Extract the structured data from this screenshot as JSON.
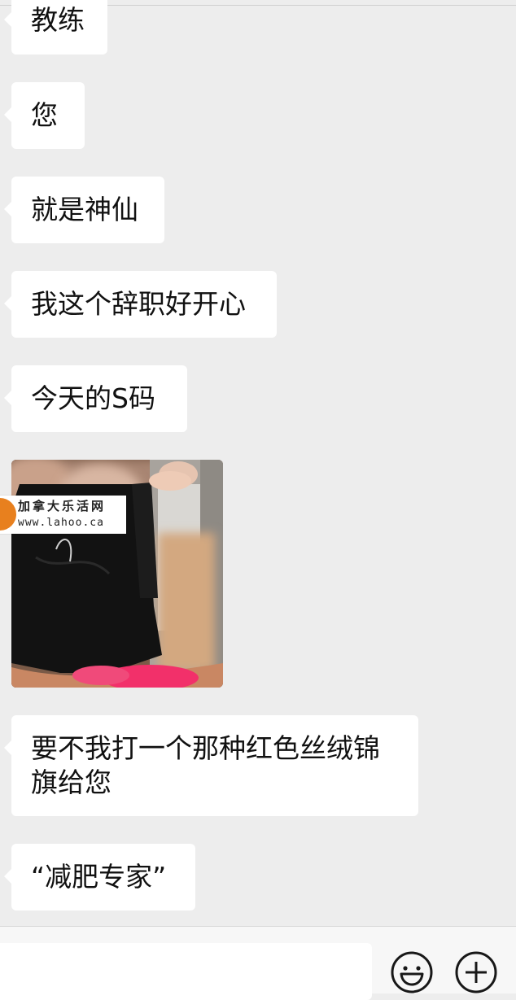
{
  "chat": {
    "messages": [
      {
        "text": "教练"
      },
      {
        "text": "您"
      },
      {
        "text": "就是神仙"
      },
      {
        "text": "我这个辞职好开心"
      },
      {
        "text": "今天的S码"
      },
      {
        "text": "要不我打一个那种红色丝绒锦\n旗给您"
      },
      {
        "text": "“减肥专家”"
      }
    ],
    "image": {
      "watermark_name": "加拿大乐活网",
      "watermark_url": "www.lahoo.ca"
    }
  },
  "input_bar": {
    "placeholder": "",
    "emoji_icon": "smiley-face-icon",
    "plus_icon": "plus-circle-icon"
  },
  "colors": {
    "background": "#ededed",
    "bubble": "#ffffff",
    "watermark_accent": "#e8801e"
  }
}
